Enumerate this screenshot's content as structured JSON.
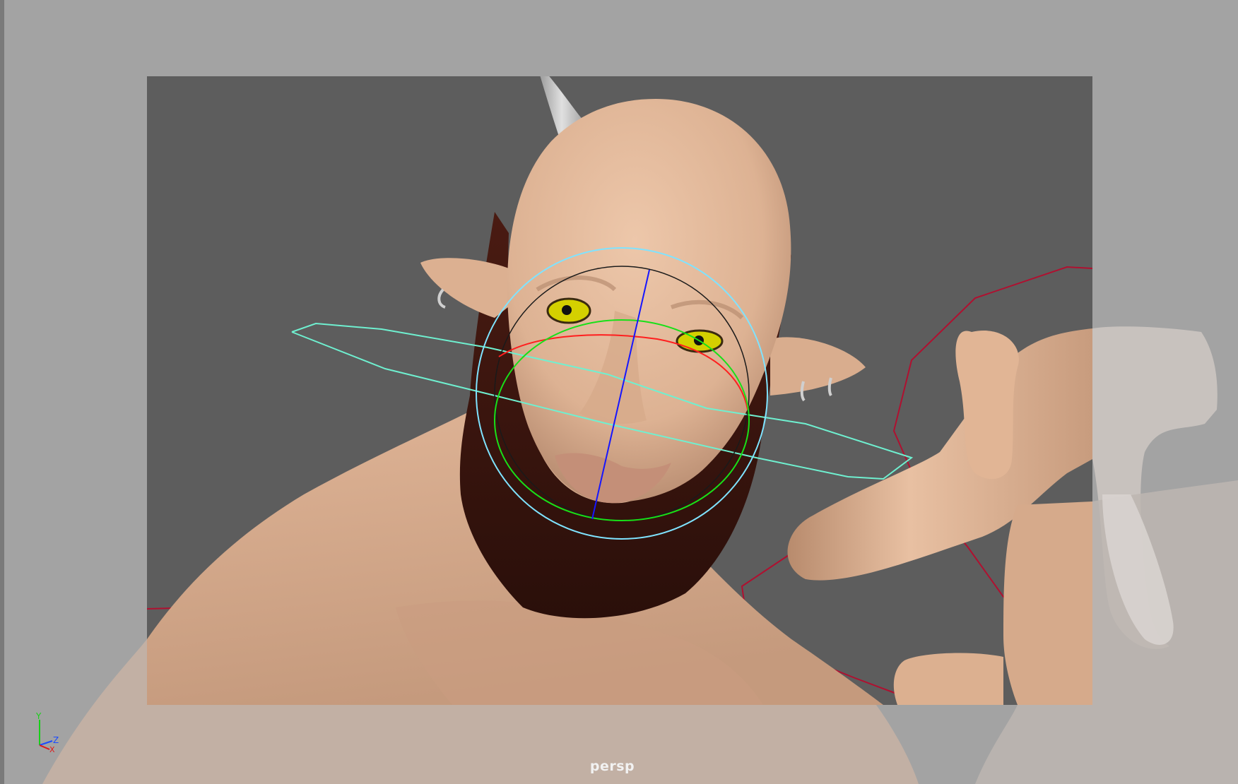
{
  "viewport": {
    "camera_label": "persp",
    "panel_type": "perspective-3d-viewport",
    "colors": {
      "outer_background": "#a3a3a3",
      "resolution_gate_background": "#5d5d5d",
      "skin": "#e2b89a",
      "beard": "#3a1510",
      "eyes": "#d4d000",
      "rotate_ring_outer": "#7fe3ff",
      "rotate_ring_x": "#ff1e1e",
      "rotate_ring_y": "#18e018",
      "rotate_axis_z": "#1616ff",
      "head_control_curve": "#6ff0d0",
      "hand_control_curve": "#b01030"
    }
  },
  "axis_indicator": {
    "labels": {
      "y": "Y",
      "z": "Z",
      "x": "X"
    },
    "colors": {
      "y": "#18d018",
      "z": "#1a4bff",
      "x": "#e01818"
    }
  }
}
